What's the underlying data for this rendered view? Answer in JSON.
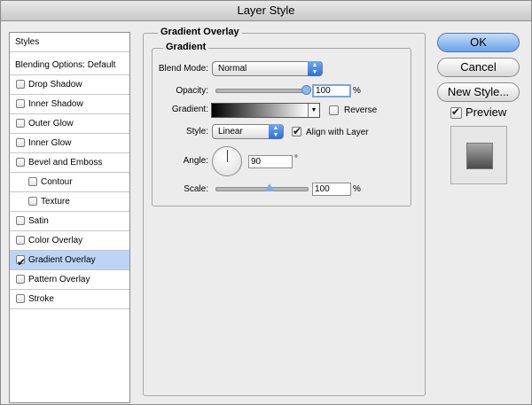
{
  "window": {
    "title": "Layer Style"
  },
  "sidebar": {
    "styles_header": "Styles",
    "blending_options": "Blending Options: Default",
    "items": [
      {
        "label": "Drop Shadow",
        "checked": false
      },
      {
        "label": "Inner Shadow",
        "checked": false
      },
      {
        "label": "Outer Glow",
        "checked": false
      },
      {
        "label": "Inner Glow",
        "checked": false
      },
      {
        "label": "Bevel and Emboss",
        "checked": false
      },
      {
        "label": "Contour",
        "checked": false
      },
      {
        "label": "Texture",
        "checked": false
      },
      {
        "label": "Satin",
        "checked": false
      },
      {
        "label": "Color Overlay",
        "checked": false
      },
      {
        "label": "Gradient Overlay",
        "checked": true
      },
      {
        "label": "Pattern Overlay",
        "checked": false
      },
      {
        "label": "Stroke",
        "checked": false
      }
    ],
    "selected_color": "#bcd5f6"
  },
  "panel": {
    "title": "Gradient Overlay",
    "group_title": "Gradient",
    "blend_mode": {
      "label": "Blend Mode:",
      "value": "Normal"
    },
    "opacity": {
      "label": "Opacity:",
      "value": "100",
      "unit": "%",
      "level_percent": 100
    },
    "gradient": {
      "label": "Gradient:",
      "reverse_label": "Reverse",
      "reverse_checked": false
    },
    "style": {
      "label": "Style:",
      "value": "Linear",
      "align_label": "Align with Layer",
      "align_checked": true
    },
    "angle": {
      "label": "Angle:",
      "value": "90",
      "unit": "°"
    },
    "scale": {
      "label": "Scale:",
      "value": "100",
      "unit": "%",
      "level_percent": 100
    }
  },
  "buttons": {
    "ok": "OK",
    "cancel": "Cancel",
    "new_style": "New Style...",
    "preview_label": "Preview",
    "preview_checked": true
  },
  "colors": {
    "accent": "#6aa2ea",
    "selection": "#bcd5f6"
  },
  "icons": {
    "popup_arrows": "up-down-arrows-icon",
    "gradient_dropdown": "triangle-down-icon",
    "angle_dial": "angle-dial-icon"
  }
}
